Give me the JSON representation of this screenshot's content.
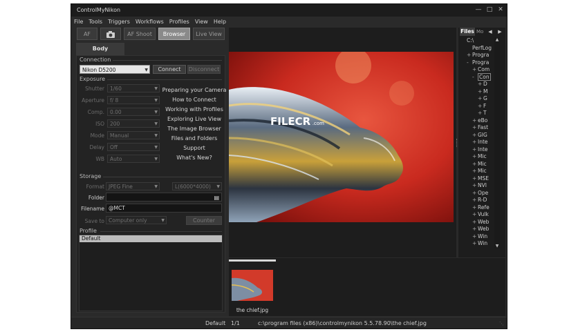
{
  "window": {
    "title": "ControlMyNikon"
  },
  "menu": [
    "File",
    "Tools",
    "Triggers",
    "Workflows",
    "Profiles",
    "View",
    "Help"
  ],
  "toolbar": {
    "af": "AF",
    "af_shoot": "AF Shoot",
    "browser": "Browser",
    "live_view": "Live View"
  },
  "body_tab": "Body",
  "connection": {
    "heading": "Connection",
    "camera": "Nikon D5200",
    "connect": "Connect",
    "disconnect": "Disconnect"
  },
  "exposure": {
    "heading": "Exposure",
    "rows": [
      {
        "label": "Shutter",
        "value": "1/60"
      },
      {
        "label": "Aperture",
        "value": "f/ 8"
      },
      {
        "label": "Comp.",
        "value": "0.00"
      },
      {
        "label": "ISO",
        "value": "200"
      },
      {
        "label": "Mode",
        "value": "Manual"
      },
      {
        "label": "Delay",
        "value": "Off"
      },
      {
        "label": "WB",
        "value": "Auto"
      }
    ]
  },
  "help_links": [
    "Preparing your Camera",
    "How to Connect",
    "Working with Profiles",
    "Exploring Live View",
    "The Image Browser",
    "Files and Folders",
    "Support",
    "What's New?"
  ],
  "storage": {
    "heading": "Storage",
    "format_label": "Format",
    "format_value": "JPEG Fine",
    "size_value": "L(6000*4000)",
    "folder_label": "Folder",
    "folder_value": "",
    "filename_label": "Filename",
    "filename_value": "@MCT",
    "saveto_label": "Save to",
    "saveto_value": "Computer only",
    "counter": "Counter"
  },
  "profile": {
    "heading": "Profile",
    "items": [
      "Default"
    ]
  },
  "watermark": {
    "brand": "FILECR",
    "sub": ".com"
  },
  "thumbnail": {
    "caption": "the chief.jpg"
  },
  "files_panel": {
    "tabs": [
      "Files",
      "Mo"
    ],
    "items": [
      {
        "indent": 1,
        "prefix": "",
        "text": "C:\\"
      },
      {
        "indent": 2,
        "prefix": "",
        "text": "PerfLog"
      },
      {
        "indent": 2,
        "prefix": "+",
        "text": "Progra"
      },
      {
        "indent": 2,
        "prefix": "-",
        "text": "Progra"
      },
      {
        "indent": 3,
        "prefix": "+",
        "text": "Com"
      },
      {
        "indent": 3,
        "prefix": "-",
        "text": "Con"
      },
      {
        "indent": 4,
        "prefix": "+",
        "text": "D"
      },
      {
        "indent": 4,
        "prefix": "+",
        "text": "M"
      },
      {
        "indent": 4,
        "prefix": "+",
        "text": "G"
      },
      {
        "indent": 4,
        "prefix": "+",
        "text": "F"
      },
      {
        "indent": 4,
        "prefix": "+",
        "text": "T"
      },
      {
        "indent": 3,
        "prefix": "+",
        "text": "eBo"
      },
      {
        "indent": 3,
        "prefix": "+",
        "text": "Fast"
      },
      {
        "indent": 3,
        "prefix": "+",
        "text": "GIG"
      },
      {
        "indent": 3,
        "prefix": "+",
        "text": "Inte"
      },
      {
        "indent": 3,
        "prefix": "+",
        "text": "Inte"
      },
      {
        "indent": 3,
        "prefix": "+",
        "text": "Mic"
      },
      {
        "indent": 3,
        "prefix": "+",
        "text": "Mic"
      },
      {
        "indent": 3,
        "prefix": "+",
        "text": "Mic"
      },
      {
        "indent": 3,
        "prefix": "+",
        "text": "MSE"
      },
      {
        "indent": 3,
        "prefix": "+",
        "text": "NVI"
      },
      {
        "indent": 3,
        "prefix": "+",
        "text": "Ope"
      },
      {
        "indent": 3,
        "prefix": "+",
        "text": "R-D"
      },
      {
        "indent": 3,
        "prefix": "+",
        "text": "Refe"
      },
      {
        "indent": 3,
        "prefix": "+",
        "text": "Vulk"
      },
      {
        "indent": 3,
        "prefix": "+",
        "text": "Web"
      },
      {
        "indent": 3,
        "prefix": "+",
        "text": "Web"
      },
      {
        "indent": 3,
        "prefix": "+",
        "text": "Win"
      },
      {
        "indent": 3,
        "prefix": "+",
        "text": "Win"
      }
    ]
  },
  "status": {
    "profile": "Default",
    "count": "1/1",
    "path": "c:\\program files (x86)\\controlmynikon 5.5.78.90\\the chief.jpg"
  }
}
